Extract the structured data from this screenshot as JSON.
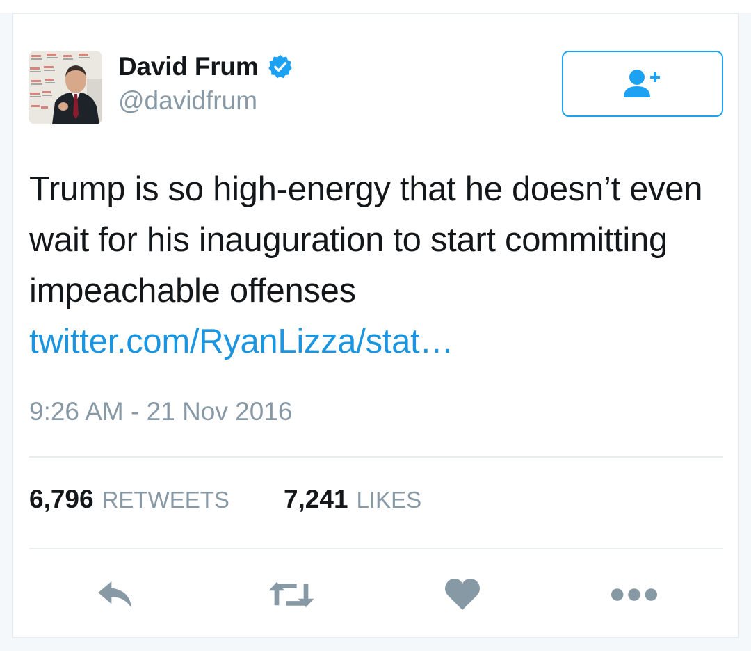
{
  "tweet": {
    "author": {
      "display_name": "David Frum",
      "handle": "@davidfrum",
      "verified": true,
      "avatar_icon": "profile-photo"
    },
    "follow_button": {
      "icon": "follow-user-plus-icon",
      "color": "#1da1f2"
    },
    "text": "Trump is so high-energy that he doesn’t even wait for his inauguration to start committing impeachable offenses",
    "link": "twitter.com/RyanLizza/stat…",
    "timestamp": "9:26 AM - 21 Nov 2016",
    "stats": {
      "retweets_count": "6,796",
      "retweets_label": "RETWEETS",
      "likes_count": "7,241",
      "likes_label": "LIKES"
    },
    "actions": [
      {
        "icon": "reply-icon"
      },
      {
        "icon": "retweet-icon"
      },
      {
        "icon": "like-heart-icon"
      },
      {
        "icon": "more-dots-icon"
      }
    ]
  },
  "colors": {
    "text": "#14171a",
    "secondary_text": "#8899a6",
    "link": "#1b95e0",
    "accent": "#1da1f2",
    "icon_gray": "#8899a6"
  }
}
